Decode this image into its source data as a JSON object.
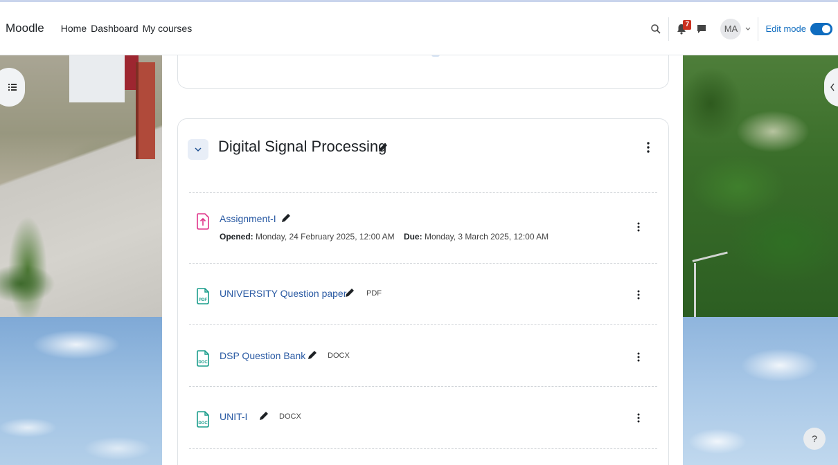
{
  "brand": "Moodle",
  "primary_nav": [
    "Home",
    "Dashboard",
    "My courses"
  ],
  "notifications_count": "7",
  "user_initials": "MA",
  "edit_mode": {
    "label": "Edit mode",
    "enabled": true
  },
  "section": {
    "title": "Digital Signal Processing",
    "activities": [
      {
        "name": "Assignment-I",
        "icon": "assignment-upload-icon",
        "opened_label": "Opened:",
        "opened_value": "Monday, 24 February 2025, 12:00 AM",
        "due_label": "Due:",
        "due_value": "Monday, 3 March 2025, 12:00 AM"
      },
      {
        "name": "UNIVERSITY Question paper",
        "icon": "pdf-file-icon",
        "type": "PDF"
      },
      {
        "name": "DSP Question Bank",
        "icon": "docx-file-icon",
        "type": "DOCX"
      },
      {
        "name": "UNIT-I",
        "icon": "docx-file-icon",
        "type": "DOCX"
      }
    ]
  },
  "help_label": "?",
  "colors": {
    "link": "#2a5aa3",
    "accent": "#0f6cbf",
    "badge": "#ca3120",
    "assign_icon": "#e0348a",
    "file_icon": "#1a9d8c"
  }
}
